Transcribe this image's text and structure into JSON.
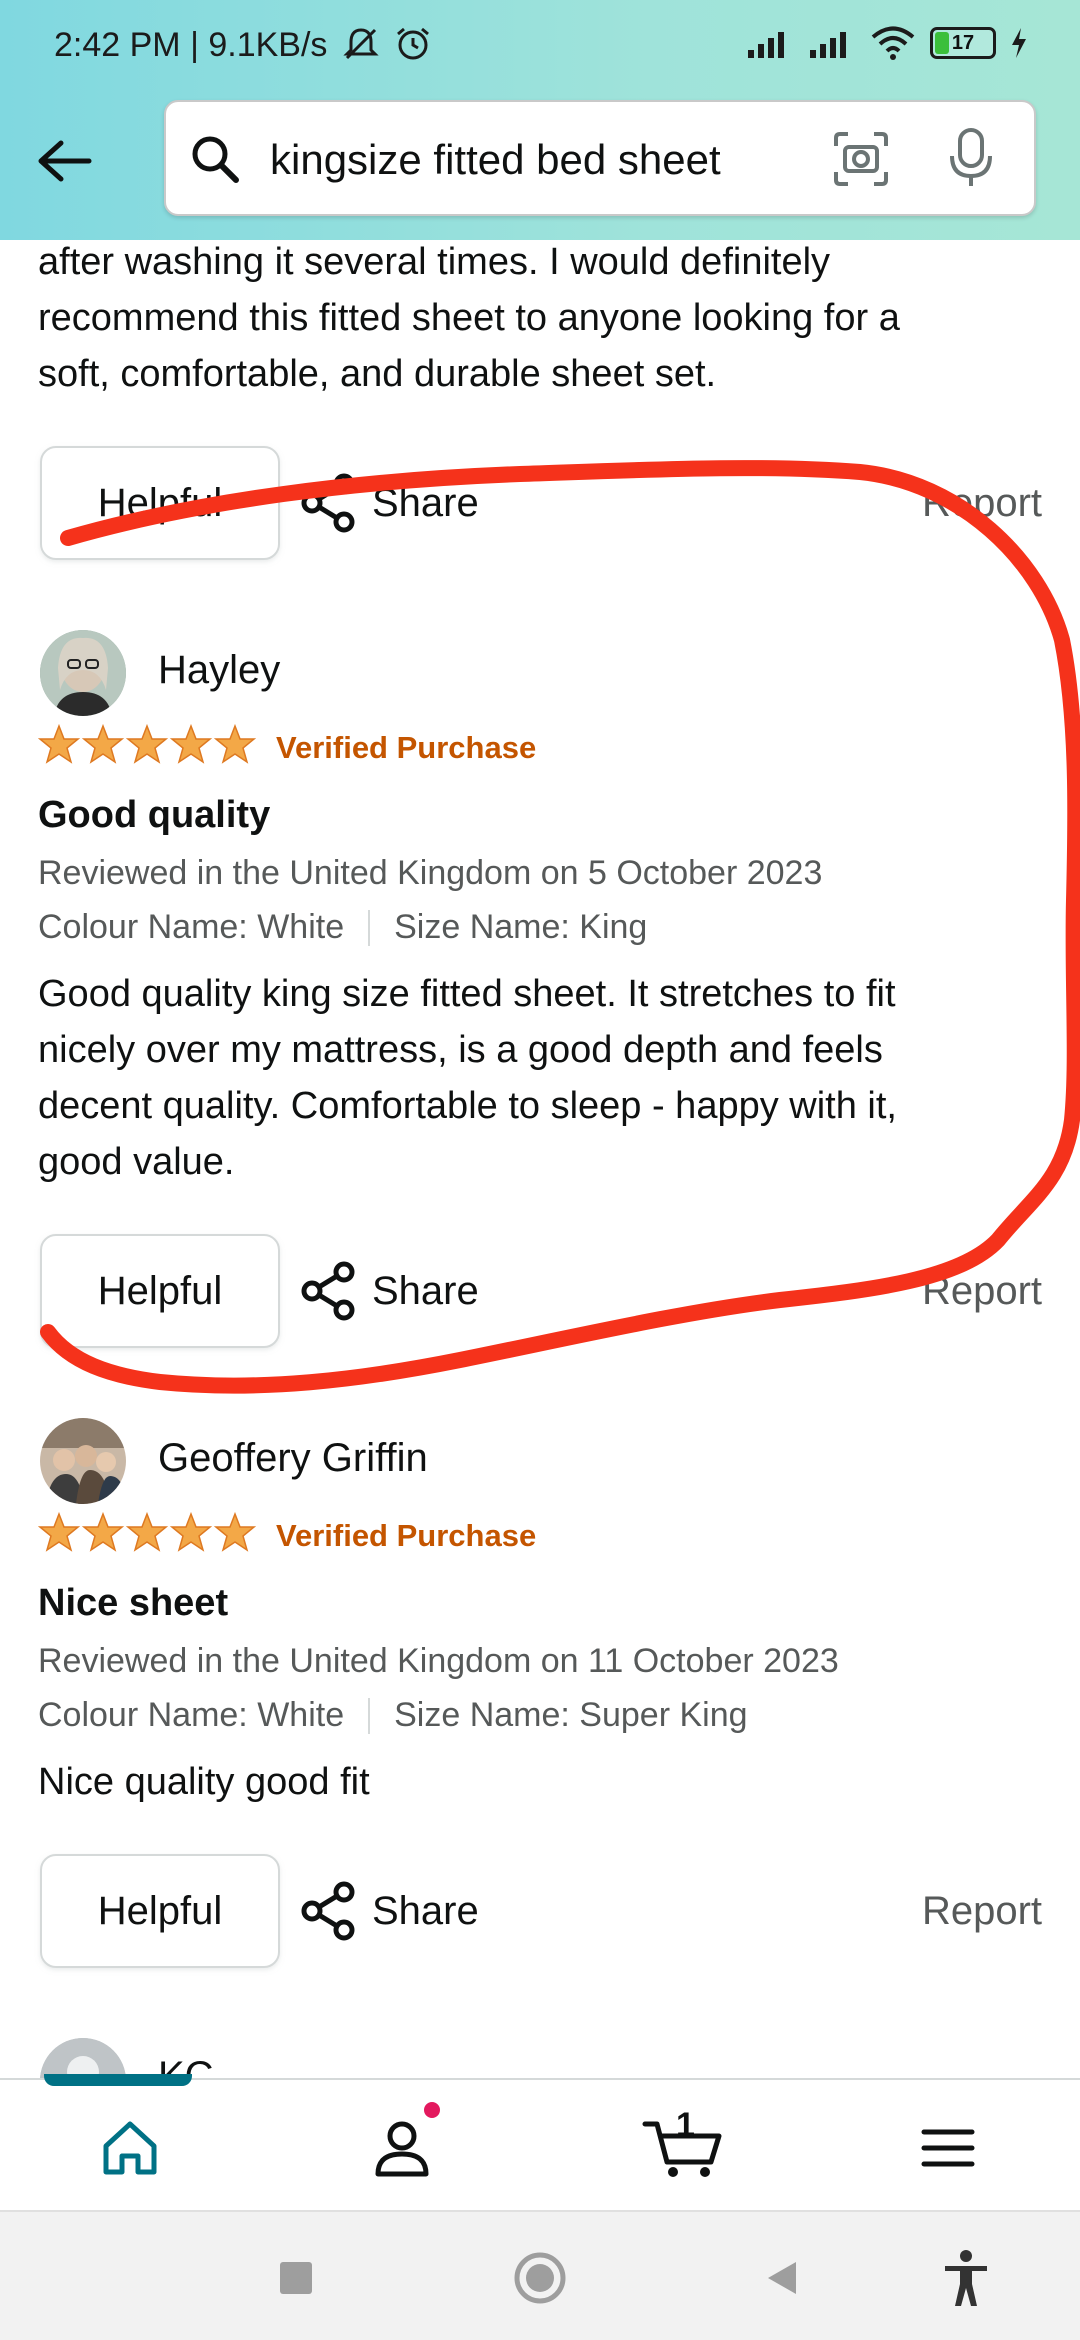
{
  "status_bar": {
    "text": "2:42 PM | 9.1KB/s",
    "battery": "17"
  },
  "search": {
    "query": "kingsize fitted bed sheet"
  },
  "previous_review": {
    "text_lines": [
      "after washing it several times. I would definitely",
      "recommend this fitted sheet to anyone looking for a",
      "soft, comfortable, and durable sheet set."
    ]
  },
  "actions": {
    "helpful": "Helpful",
    "share": "Share",
    "report": "Report"
  },
  "reviews": [
    {
      "name": "Hayley",
      "rating": 5,
      "verified": "Verified Purchase",
      "title": "Good quality",
      "reviewed": "Reviewed in the United Kingdom on 5 October 2023",
      "colour": "Colour Name: White",
      "size": "Size Name: King",
      "body_lines": [
        "Good quality king size fitted sheet. It stretches to fit",
        "nicely over my mattress, is a good depth and feels",
        "decent quality. Comfortable to sleep - happy with it,",
        "good value."
      ]
    },
    {
      "name": "Geoffery Griffin",
      "rating": 5,
      "verified": "Verified Purchase",
      "title": "Nice sheet",
      "reviewed": "Reviewed in the United Kingdom on 11 October 2023",
      "colour": "Colour Name: White",
      "size": "Size Name: Super King",
      "body_lines": [
        "Nice quality good fit"
      ]
    },
    {
      "name": "KC"
    }
  ],
  "bottom_nav": {
    "cart_count": "1",
    "items": [
      "home-icon",
      "account-icon",
      "cart-icon",
      "menu-icon"
    ]
  },
  "colors": {
    "accent": "#007185",
    "verified": "#c45500",
    "star": "#f3a847",
    "annotation": "#f5321b"
  }
}
